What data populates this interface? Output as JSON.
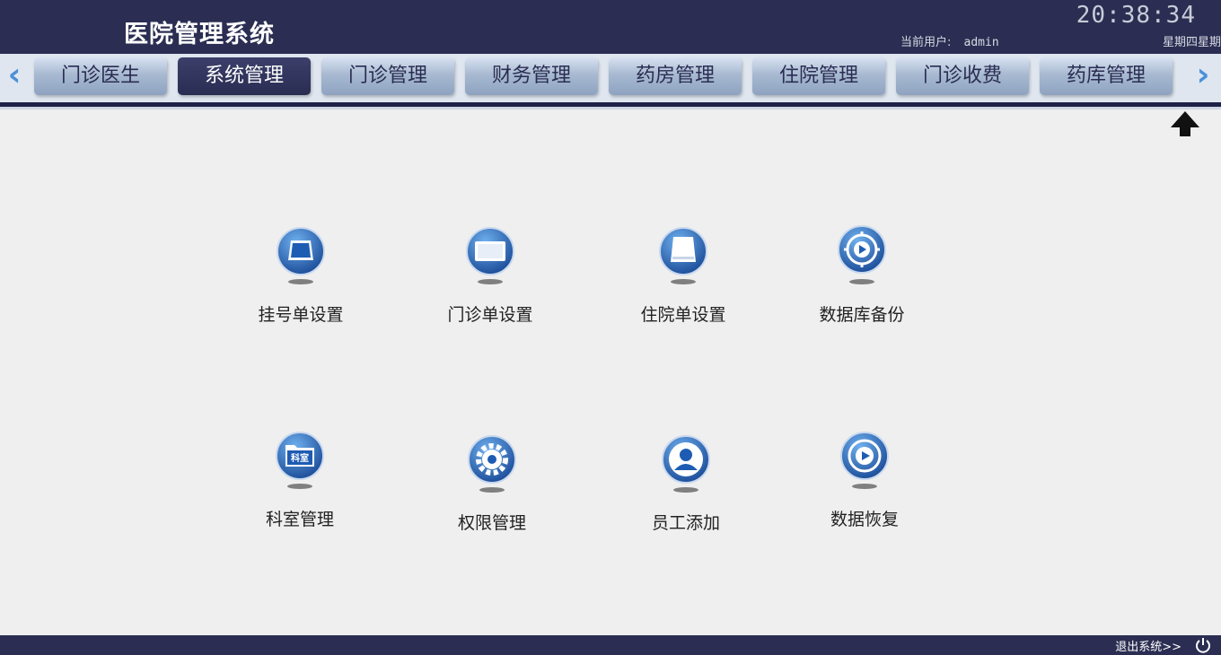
{
  "header": {
    "title": "医院管理系统",
    "clock": "20:38:34",
    "user_label": "当前用户:",
    "user_name": "admin",
    "weekday": "星期四星期"
  },
  "nav": {
    "tabs": [
      {
        "label": "门诊医生",
        "active": false
      },
      {
        "label": "系统管理",
        "active": true
      },
      {
        "label": "门诊管理",
        "active": false
      },
      {
        "label": "财务管理",
        "active": false
      },
      {
        "label": "药房管理",
        "active": false
      },
      {
        "label": "住院管理",
        "active": false
      },
      {
        "label": "门诊收费",
        "active": false
      },
      {
        "label": "药库管理",
        "active": false
      }
    ],
    "left_arrow_icon": "chevron-left-icon",
    "right_arrow_icon": "chevron-right-icon"
  },
  "tiles": [
    {
      "label": "挂号单设置",
      "icon": "card-icon"
    },
    {
      "label": "门诊单设置",
      "icon": "monitor-icon"
    },
    {
      "label": "住院单设置",
      "icon": "drive-icon"
    },
    {
      "label": "数据库备份",
      "icon": "disc-icon"
    },
    {
      "label": "科室管理",
      "icon": "folder-icon",
      "icon_text": "科室"
    },
    {
      "label": "权限管理",
      "icon": "gear-icon"
    },
    {
      "label": "员工添加",
      "icon": "user-icon"
    },
    {
      "label": "数据恢复",
      "icon": "disc-play-icon"
    }
  ],
  "footer": {
    "logout": "退出系统>>",
    "power_icon": "power-icon"
  },
  "colors": {
    "header_bg": "#2b2e52",
    "nav_bg": "#dfe6ef",
    "tab_active": "#2a2d52",
    "accent_blue": "#2f6fc2"
  }
}
